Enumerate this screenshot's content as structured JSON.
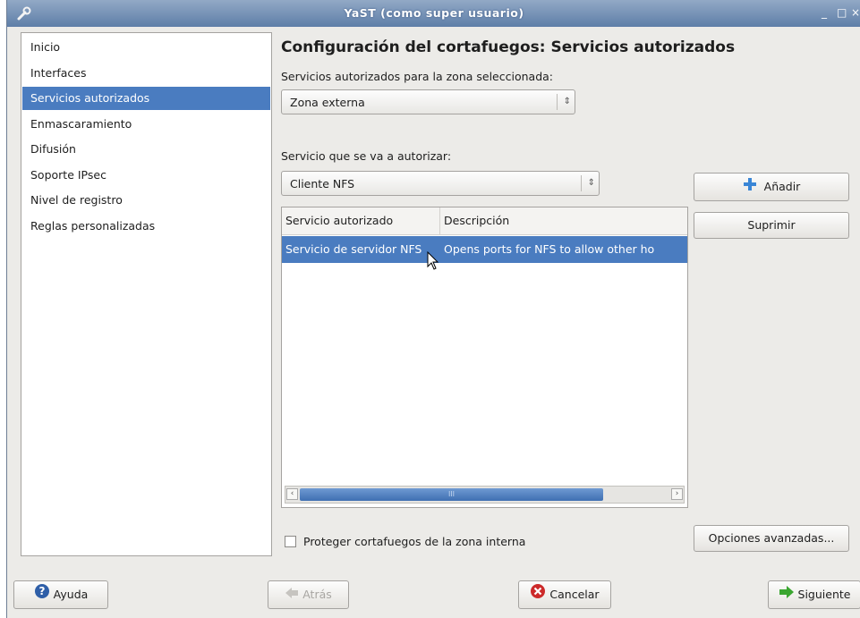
{
  "window": {
    "title": "YaST (como super usuario)",
    "minimize": "_",
    "maximize": "□",
    "close": "×"
  },
  "nav": {
    "items": [
      "Inicio",
      "Interfaces",
      "Servicios autorizados",
      "Enmascaramiento",
      "Difusión",
      "Soporte IPsec",
      "Nivel de registro",
      "Reglas personalizadas"
    ],
    "selected": "Servicios autorizados"
  },
  "main": {
    "heading": "Configuración del cortafuegos: Servicios autorizados",
    "zone_label": "Servicios autorizados para la zona seleccionada:",
    "zone_value": "Zona externa",
    "service_label": "Servicio que se va a autorizar:",
    "service_value": "Cliente NFS",
    "add_button": "Añadir",
    "remove_button": "Suprimir",
    "table": {
      "columns": [
        "Servicio autorizado",
        "Descripción"
      ],
      "rows": [
        {
          "service": "Servicio de servidor NFS",
          "description": "Opens ports for NFS to allow other ho"
        }
      ],
      "scroll_grip": "III"
    },
    "protect_checkbox": {
      "label": "Proteger cortafuegos de la zona interna",
      "checked": false
    },
    "advanced_button": "Opciones avanzadas..."
  },
  "footer": {
    "help": "Ayuda",
    "back": "Atrás",
    "cancel": "Cancelar",
    "next": "Siguiente"
  },
  "colors": {
    "selection": "#4a7cc0",
    "titlebar": "#6f8cb3",
    "add_icon": "#3a86d6",
    "cancel_icon": "#cc2a2a",
    "next_icon": "#3aa630",
    "help_icon": "#2f5fa8"
  }
}
